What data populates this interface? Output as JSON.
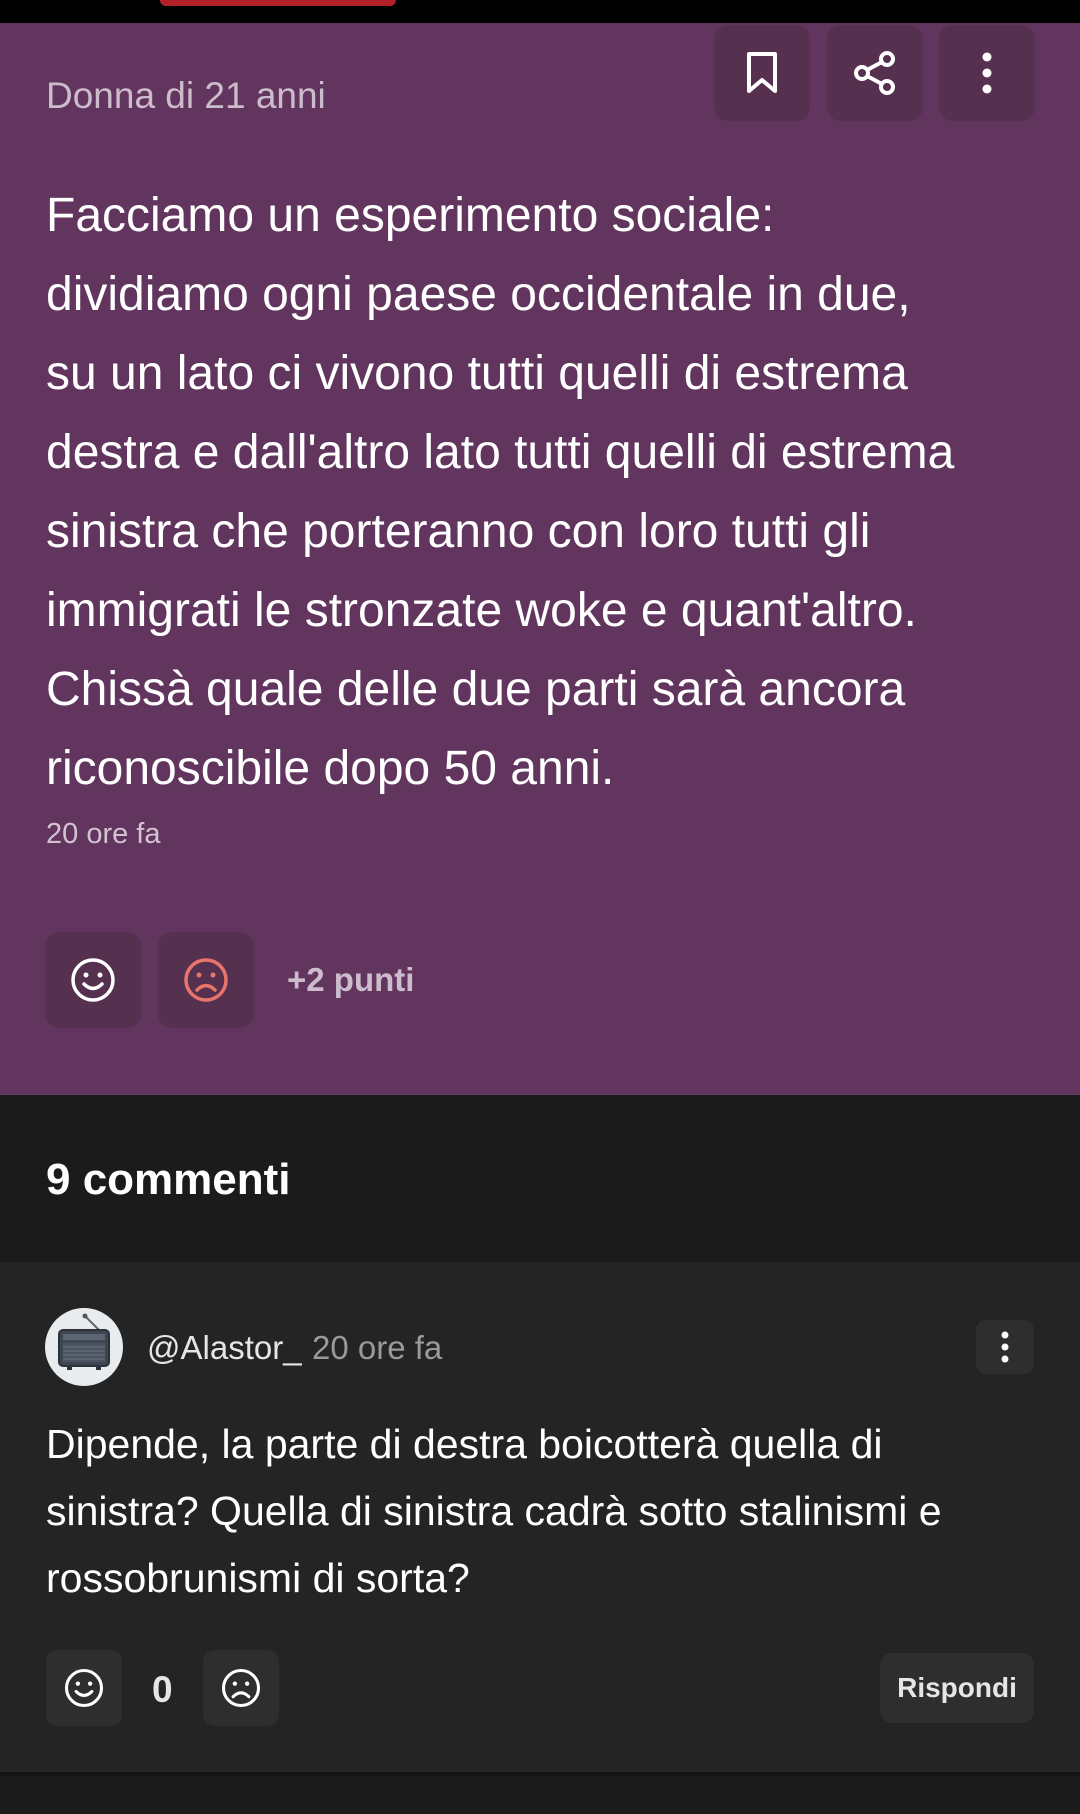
{
  "post": {
    "author": "Donna di 21 anni",
    "body": "Facciamo un esperimento sociale:\ndividiamo ogni paese occidentale in due,\nsu un lato ci vivono tutti quelli di estrema\ndestra e dall'altro lato tutti quelli di estrema\nsinistra che porteranno con loro tutti gli\nimmigrati le stronzate woke e quant'altro.\nChissà quale delle due parti sarà ancora\nriconoscibile dopo 50 anni.",
    "time": "20 ore fa",
    "points": "+2 punti",
    "icons": {
      "bookmark": "bookmark-icon",
      "share": "share-icon",
      "more": "more-vertical-icon",
      "like": "smile-icon",
      "dislike": "frown-icon"
    }
  },
  "comments": {
    "count_label": "9 commenti",
    "items": [
      {
        "username": "@Alastor_",
        "time": "20 ore fa",
        "body": "Dipende, la parte di destra boicotterà quella di sinistra? Quella di sinistra cadrà sotto stalinismi e rossobrunismi di sorta?",
        "score": "0",
        "reply_label": "Rispondi"
      }
    ]
  },
  "colors": {
    "post_background": "#62355e",
    "post_button": "#56304f",
    "dislike_accent": "#e8756b",
    "page_background": "#1a1a1a",
    "comment_background": "#242424"
  }
}
